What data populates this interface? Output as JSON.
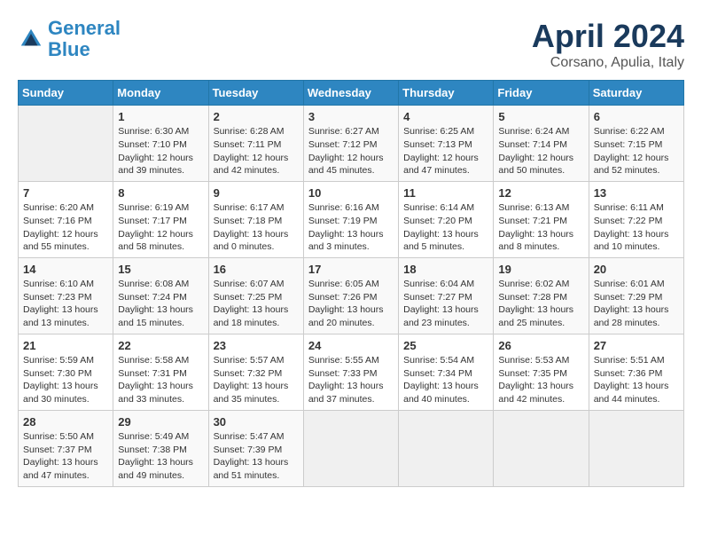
{
  "header": {
    "logo_line1": "General",
    "logo_line2": "Blue",
    "month": "April 2024",
    "location": "Corsano, Apulia, Italy"
  },
  "weekdays": [
    "Sunday",
    "Monday",
    "Tuesday",
    "Wednesday",
    "Thursday",
    "Friday",
    "Saturday"
  ],
  "weeks": [
    [
      {
        "day": "",
        "sunrise": "",
        "sunset": "",
        "daylight": ""
      },
      {
        "day": "1",
        "sunrise": "Sunrise: 6:30 AM",
        "sunset": "Sunset: 7:10 PM",
        "daylight": "Daylight: 12 hours and 39 minutes."
      },
      {
        "day": "2",
        "sunrise": "Sunrise: 6:28 AM",
        "sunset": "Sunset: 7:11 PM",
        "daylight": "Daylight: 12 hours and 42 minutes."
      },
      {
        "day": "3",
        "sunrise": "Sunrise: 6:27 AM",
        "sunset": "Sunset: 7:12 PM",
        "daylight": "Daylight: 12 hours and 45 minutes."
      },
      {
        "day": "4",
        "sunrise": "Sunrise: 6:25 AM",
        "sunset": "Sunset: 7:13 PM",
        "daylight": "Daylight: 12 hours and 47 minutes."
      },
      {
        "day": "5",
        "sunrise": "Sunrise: 6:24 AM",
        "sunset": "Sunset: 7:14 PM",
        "daylight": "Daylight: 12 hours and 50 minutes."
      },
      {
        "day": "6",
        "sunrise": "Sunrise: 6:22 AM",
        "sunset": "Sunset: 7:15 PM",
        "daylight": "Daylight: 12 hours and 52 minutes."
      }
    ],
    [
      {
        "day": "7",
        "sunrise": "Sunrise: 6:20 AM",
        "sunset": "Sunset: 7:16 PM",
        "daylight": "Daylight: 12 hours and 55 minutes."
      },
      {
        "day": "8",
        "sunrise": "Sunrise: 6:19 AM",
        "sunset": "Sunset: 7:17 PM",
        "daylight": "Daylight: 12 hours and 58 minutes."
      },
      {
        "day": "9",
        "sunrise": "Sunrise: 6:17 AM",
        "sunset": "Sunset: 7:18 PM",
        "daylight": "Daylight: 13 hours and 0 minutes."
      },
      {
        "day": "10",
        "sunrise": "Sunrise: 6:16 AM",
        "sunset": "Sunset: 7:19 PM",
        "daylight": "Daylight: 13 hours and 3 minutes."
      },
      {
        "day": "11",
        "sunrise": "Sunrise: 6:14 AM",
        "sunset": "Sunset: 7:20 PM",
        "daylight": "Daylight: 13 hours and 5 minutes."
      },
      {
        "day": "12",
        "sunrise": "Sunrise: 6:13 AM",
        "sunset": "Sunset: 7:21 PM",
        "daylight": "Daylight: 13 hours and 8 minutes."
      },
      {
        "day": "13",
        "sunrise": "Sunrise: 6:11 AM",
        "sunset": "Sunset: 7:22 PM",
        "daylight": "Daylight: 13 hours and 10 minutes."
      }
    ],
    [
      {
        "day": "14",
        "sunrise": "Sunrise: 6:10 AM",
        "sunset": "Sunset: 7:23 PM",
        "daylight": "Daylight: 13 hours and 13 minutes."
      },
      {
        "day": "15",
        "sunrise": "Sunrise: 6:08 AM",
        "sunset": "Sunset: 7:24 PM",
        "daylight": "Daylight: 13 hours and 15 minutes."
      },
      {
        "day": "16",
        "sunrise": "Sunrise: 6:07 AM",
        "sunset": "Sunset: 7:25 PM",
        "daylight": "Daylight: 13 hours and 18 minutes."
      },
      {
        "day": "17",
        "sunrise": "Sunrise: 6:05 AM",
        "sunset": "Sunset: 7:26 PM",
        "daylight": "Daylight: 13 hours and 20 minutes."
      },
      {
        "day": "18",
        "sunrise": "Sunrise: 6:04 AM",
        "sunset": "Sunset: 7:27 PM",
        "daylight": "Daylight: 13 hours and 23 minutes."
      },
      {
        "day": "19",
        "sunrise": "Sunrise: 6:02 AM",
        "sunset": "Sunset: 7:28 PM",
        "daylight": "Daylight: 13 hours and 25 minutes."
      },
      {
        "day": "20",
        "sunrise": "Sunrise: 6:01 AM",
        "sunset": "Sunset: 7:29 PM",
        "daylight": "Daylight: 13 hours and 28 minutes."
      }
    ],
    [
      {
        "day": "21",
        "sunrise": "Sunrise: 5:59 AM",
        "sunset": "Sunset: 7:30 PM",
        "daylight": "Daylight: 13 hours and 30 minutes."
      },
      {
        "day": "22",
        "sunrise": "Sunrise: 5:58 AM",
        "sunset": "Sunset: 7:31 PM",
        "daylight": "Daylight: 13 hours and 33 minutes."
      },
      {
        "day": "23",
        "sunrise": "Sunrise: 5:57 AM",
        "sunset": "Sunset: 7:32 PM",
        "daylight": "Daylight: 13 hours and 35 minutes."
      },
      {
        "day": "24",
        "sunrise": "Sunrise: 5:55 AM",
        "sunset": "Sunset: 7:33 PM",
        "daylight": "Daylight: 13 hours and 37 minutes."
      },
      {
        "day": "25",
        "sunrise": "Sunrise: 5:54 AM",
        "sunset": "Sunset: 7:34 PM",
        "daylight": "Daylight: 13 hours and 40 minutes."
      },
      {
        "day": "26",
        "sunrise": "Sunrise: 5:53 AM",
        "sunset": "Sunset: 7:35 PM",
        "daylight": "Daylight: 13 hours and 42 minutes."
      },
      {
        "day": "27",
        "sunrise": "Sunrise: 5:51 AM",
        "sunset": "Sunset: 7:36 PM",
        "daylight": "Daylight: 13 hours and 44 minutes."
      }
    ],
    [
      {
        "day": "28",
        "sunrise": "Sunrise: 5:50 AM",
        "sunset": "Sunset: 7:37 PM",
        "daylight": "Daylight: 13 hours and 47 minutes."
      },
      {
        "day": "29",
        "sunrise": "Sunrise: 5:49 AM",
        "sunset": "Sunset: 7:38 PM",
        "daylight": "Daylight: 13 hours and 49 minutes."
      },
      {
        "day": "30",
        "sunrise": "Sunrise: 5:47 AM",
        "sunset": "Sunset: 7:39 PM",
        "daylight": "Daylight: 13 hours and 51 minutes."
      },
      {
        "day": "",
        "sunrise": "",
        "sunset": "",
        "daylight": ""
      },
      {
        "day": "",
        "sunrise": "",
        "sunset": "",
        "daylight": ""
      },
      {
        "day": "",
        "sunrise": "",
        "sunset": "",
        "daylight": ""
      },
      {
        "day": "",
        "sunrise": "",
        "sunset": "",
        "daylight": ""
      }
    ]
  ]
}
